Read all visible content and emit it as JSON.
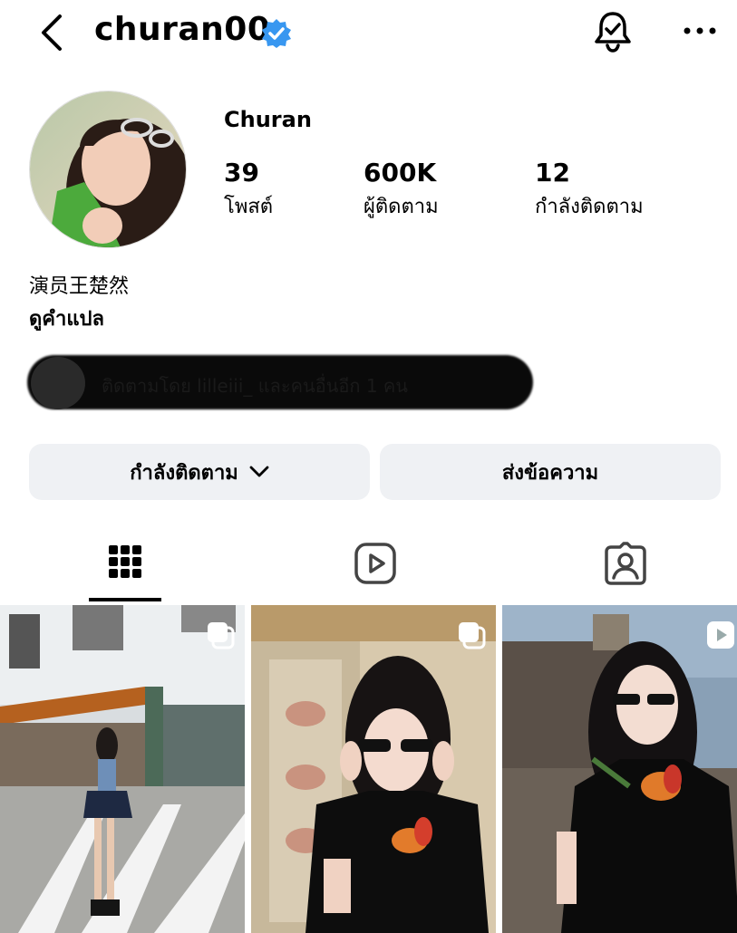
{
  "header": {
    "username": "churan00"
  },
  "profile": {
    "full_name": "Churan",
    "stats": [
      {
        "value": "39",
        "label": "โพสต์"
      },
      {
        "value": "600K",
        "label": "ผู้ติดตาม"
      },
      {
        "value": "12",
        "label": "กำลังติดตาม"
      }
    ],
    "bio": "演员王楚然",
    "translate_link": "ดูคำแปล",
    "followed_by": "ติดตามโดย lilleiii_ และคนอื่นอีก 1 คน"
  },
  "actions": {
    "following_label": "กำลังติดตาม",
    "message_label": "ส่งข้อความ"
  },
  "tabs": [
    {
      "icon": "grid-icon",
      "active": true
    },
    {
      "icon": "reels-icon",
      "active": false
    },
    {
      "icon": "tagged-icon",
      "active": false
    }
  ],
  "colors": {
    "verified": "#3897f0",
    "button_bg": "#eff1f4"
  },
  "posts": [
    {
      "type": "multi-photo"
    },
    {
      "type": "multi-photo"
    },
    {
      "type": "video"
    }
  ]
}
